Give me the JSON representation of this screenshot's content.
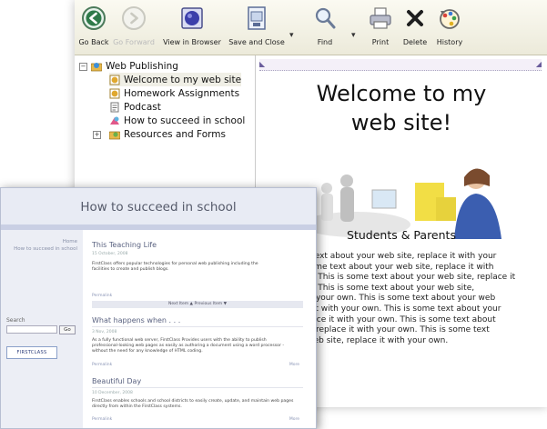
{
  "editor": {
    "toolbar": [
      {
        "name": "go-back-button",
        "icon": "back-arrow-icon",
        "label": "Go Back",
        "enabled": true
      },
      {
        "name": "go-forward-button",
        "icon": "forward-arrow-icon",
        "label": "Go Forward",
        "enabled": false
      },
      {
        "name": "view-in-browser-button",
        "icon": "browser-globe-icon",
        "label": "View in Browser",
        "enabled": true
      },
      {
        "name": "save-and-close-button",
        "icon": "save-document-icon",
        "label": "Save and Close",
        "enabled": true
      },
      {
        "name": "find-button",
        "icon": "magnifier-icon",
        "label": "Find",
        "enabled": true
      },
      {
        "name": "print-button",
        "icon": "printer-icon",
        "label": "Print",
        "enabled": true
      },
      {
        "name": "delete-button",
        "icon": "delete-x-icon",
        "label": "Delete",
        "enabled": true
      },
      {
        "name": "history-button",
        "icon": "history-icon",
        "label": "History",
        "enabled": true
      }
    ],
    "dropdown_arrow": "▾",
    "tree": {
      "root": {
        "label": "Web Publishing",
        "expander": "−"
      },
      "items": [
        {
          "label": "Welcome to my web site",
          "icon": "web-page-icon"
        },
        {
          "label": "Homework Assignments",
          "icon": "web-page-icon"
        },
        {
          "label": "Podcast",
          "icon": "podcast-icon"
        },
        {
          "label": "How to succeed in school",
          "icon": "blog-icon"
        },
        {
          "label": "Resources and Forms",
          "icon": "folder-icon",
          "expander": "+"
        }
      ]
    },
    "document": {
      "heading_line1": "Welcome to my",
      "heading_line2": "web site!",
      "subheading": "Students & Parents",
      "body_lines": [
        "me text about your web site, replace it with your",
        "is some text about your web site, replace it with",
        "own. This is some text about your web site, replace it",
        "own. This is some text about your web site,",
        "with your own. This is some text about your web",
        "ace it with your own. This is some text about your",
        "replace it with your own. This is some text about",
        "site, replace it with your own. This is some text",
        "ur web site, replace it with your own."
      ]
    }
  },
  "blog": {
    "title": "How to succeed in school",
    "side_links": [
      "Home",
      "How to succeed in school"
    ],
    "search_label": "Search",
    "go_label": "Go",
    "badge": "FIRSTCLASS",
    "posts": [
      {
        "title": "This Teaching Life",
        "date": "15 October, 2008",
        "body": [
          "FirstClass offers popular technologies for personal web publishing including the",
          "facilities to create and publish blogs."
        ],
        "link": "Permalink",
        "more": ""
      },
      {
        "title": "What happens when . . .",
        "date": "3 Nov, 2008",
        "body": [
          "As a fully functional web server, FirstClass Provides users with the ability to publish",
          "professional-looking web pages as easily as authoring a document using a word processor -",
          "without the need for any knowledge of HTML coding."
        ],
        "link": "Permalink",
        "more": "More"
      },
      {
        "title": "Beautiful Day",
        "date": "10 December, 2008",
        "body": [
          "FirstClass enables schools and school districts to easily create, update, and maintain web pages",
          "directly from within the FirstClass systems."
        ],
        "link": "Permalink",
        "more": "More"
      }
    ],
    "nav": "Next Item ▲   Previous Item ▼"
  }
}
